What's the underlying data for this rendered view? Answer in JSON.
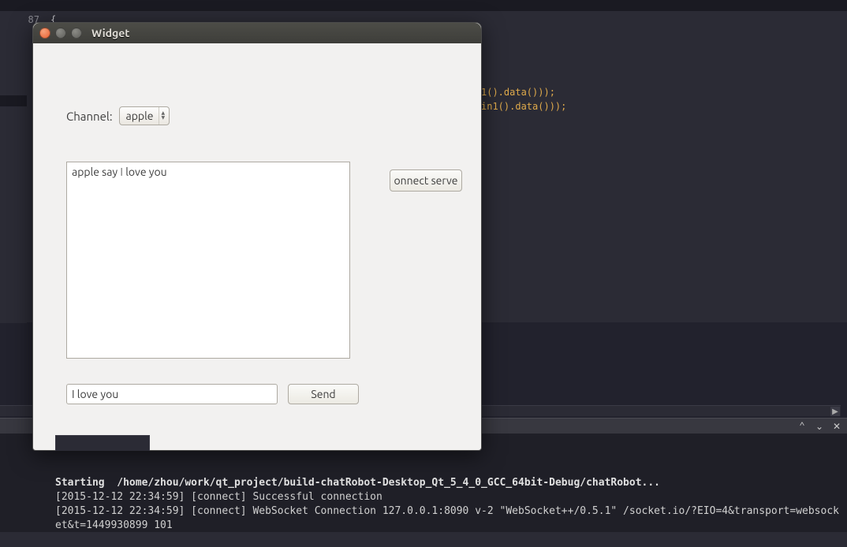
{
  "editor": {
    "visible_line_number": "87",
    "visible_brace": "{",
    "code_fragment_1": "1().data()));",
    "code_fragment_2": "in1().data()));"
  },
  "output_header": {
    "collapse_icon": "^",
    "expand_icon": "⌄",
    "close_icon": "✕"
  },
  "output": {
    "line1": "Starting  /home/zhou/work/qt_project/build-chatRobot-Desktop_Qt_5_4_0_GCC_64bit-Debug/chatRobot...",
    "line2": "[2015-12-12 22:34:59] [connect] Successful connection",
    "line3": "[2015-12-12 22:34:59] [connect] WebSocket Connection 127.0.0.1:8090 v-2 \"WebSocket++/0.5.1\" /socket.io/?EIO=4&transport=websocket&t=1449930899 101"
  },
  "dialog": {
    "title": "Widget",
    "channel_label": "Channel:",
    "channel_value": "apple",
    "log_text_prefix": "apple say ",
    "log_text_i": "I",
    "log_text_suffix": " love you",
    "connect_button": "onnect serve",
    "message_value": "I love you",
    "send_button": "Send"
  }
}
